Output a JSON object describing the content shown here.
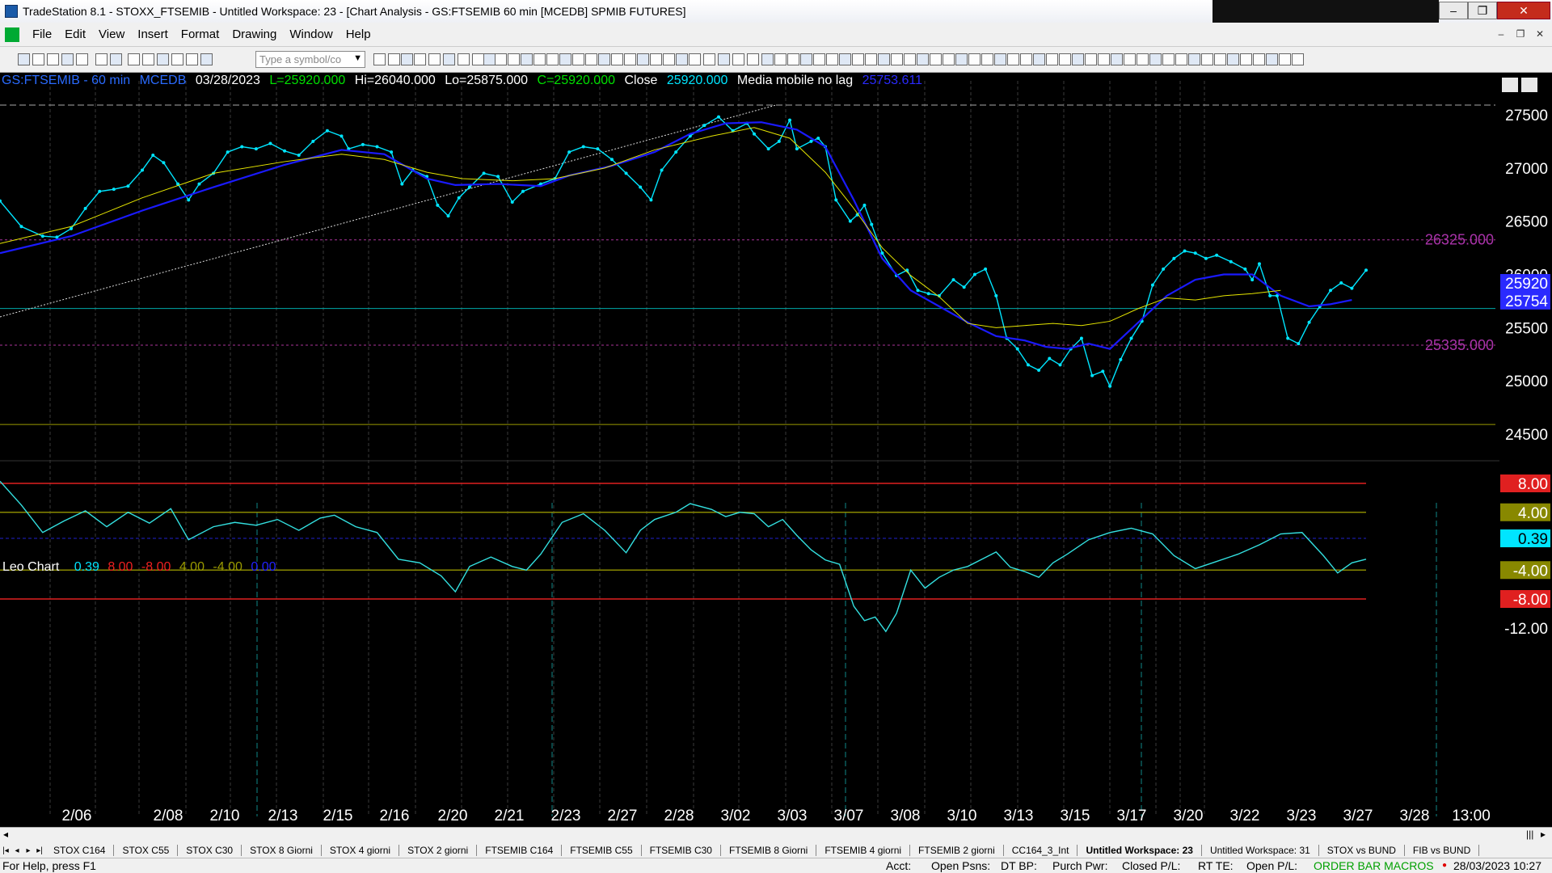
{
  "window": {
    "title": "TradeStation 8.1 - STOXX_FTSEMIB - Untitled Workspace: 23 - [Chart Analysis - GS:FTSEMIB  60 min  [MCEDB] SPMIB FUTURES]",
    "min": "–",
    "max": "❐",
    "close": "✕"
  },
  "menu": [
    "File",
    "Edit",
    "View",
    "Insert",
    "Format",
    "Drawing",
    "Window",
    "Help"
  ],
  "toolbar": {
    "symbol_placeholder": "Type a symbol/co"
  },
  "info": {
    "symbol": "GS:FTSEMIB - 60 min",
    "exchange": "MCEDB",
    "date": "03/28/2023",
    "last": "L=25920.000",
    "high": "Hi=26040.000",
    "low": "Lo=25875.000",
    "close": "C=25920.000",
    "close_label": "Close",
    "close_value": "25920.000",
    "indicator": "Media mobile no lag",
    "indicator_value": "25753.611"
  },
  "price_axis": [
    "27500",
    "27000",
    "26500",
    "26000",
    "25500",
    "25000",
    "24500"
  ],
  "levels": {
    "upper": "26325.000",
    "lower": "25335.000"
  },
  "price_badges": {
    "last": "25920",
    "avg": "25754"
  },
  "osc": {
    "name": "Leo Chart",
    "values": [
      "0.39",
      "8.00",
      "-8.00",
      "4.00",
      "-4.00",
      "0.00"
    ],
    "axis": [
      "8.00",
      "4.00",
      "0.39",
      "-4.00",
      "-8.00",
      "-12.00"
    ]
  },
  "dates": [
    "2/06",
    "2/08",
    "2/10",
    "2/13",
    "2/15",
    "2/16",
    "2/20",
    "2/21",
    "2/23",
    "2/27",
    "2/28",
    "3/02",
    "3/03",
    "3/07",
    "3/08",
    "3/10",
    "3/13",
    "3/15",
    "3/17",
    "3/20",
    "3/22",
    "3/23",
    "3/27",
    "3/28",
    "13:00"
  ],
  "tabs": [
    "STOX C164",
    "STOX C55",
    "STOX  C30",
    "STOX  8 Giorni",
    "STOX 4 giorni",
    "STOX  2 giorni",
    "FTSEMIB C164",
    "FTSEMIB C55",
    "FTSEMIB C30",
    "FTSEMIB  8 Giorni",
    "FTSEMIB  4 giorni",
    "FTSEMIB  2 giorni",
    "CC164_3_Int",
    "Untitled Workspace:  23",
    "Untitled Workspace:  31",
    "STOX vs BUND",
    "FIB vs BUND"
  ],
  "status": {
    "help": "For Help, press F1",
    "acct": "Acct:",
    "open_psns": "Open Psns:",
    "dt_bp": "DT BP:",
    "purch_pwr": "Purch Pwr:",
    "closed_pl": "Closed P/L:",
    "rt_te": "RT TE:",
    "open_pl": "Open P/L:",
    "macros": "ORDER BAR  MACROS",
    "datetime": "28/03/2023 10:27"
  },
  "colors": {
    "price": "#00e5ff",
    "avg1": "#1a1aff",
    "avg2": "#e6e600",
    "resist": "#cc33cc"
  }
}
